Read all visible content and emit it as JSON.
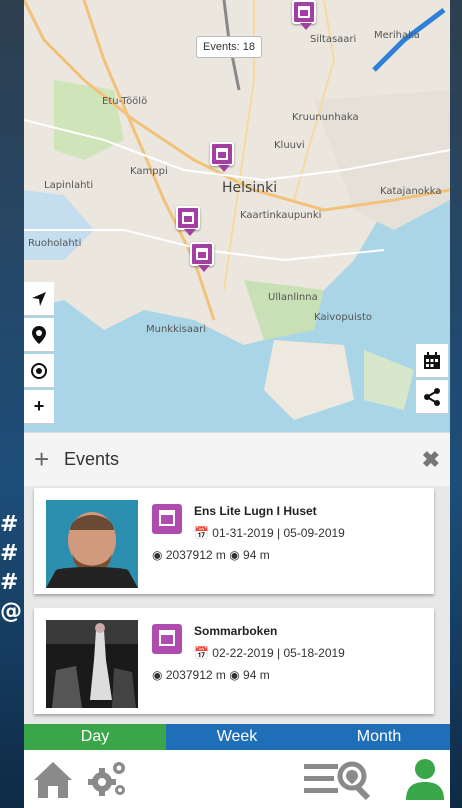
{
  "hash_marks": [
    "#",
    "#",
    "#",
    "@"
  ],
  "map": {
    "events_count": "Events: 18",
    "labels": {
      "helsinki": "Helsinki",
      "kamppi": "Kamppi",
      "kruununhaka": "Kruununhaka",
      "kaartinkaupunki": "Kaartinkaupunki",
      "ullanlinna": "Ullanlinna",
      "kaivopuisto": "Kaivopuisto",
      "munkkisaari": "Munkkisaari",
      "katajanokka": "Katajanokka",
      "lapinlahti": "Lapinlahti",
      "ruoholahti": "Ruoholahti",
      "etu_toolo": "Etu-Töölö",
      "kluuvi": "Kluuvi",
      "merihaka": "Merihaka",
      "siltasaari": "Siltasaari"
    },
    "controls": {
      "locate": "locate-arrow",
      "place": "map-pin",
      "center": "target",
      "zoom_in": "+"
    },
    "right_controls": {
      "calendar": "calendar",
      "share": "share"
    }
  },
  "events_panel": {
    "title": "Events",
    "add_icon": "+",
    "close_icon": "✖",
    "items": [
      {
        "name": "Ens Lite Lugn I Huset",
        "dates": "01-31-2019 | 05-09-2019",
        "distance": "2037912 m",
        "proximity": "94 m"
      },
      {
        "name": "Sommarboken",
        "dates": "02-22-2019 | 05-18-2019",
        "distance": "2037912 m",
        "proximity": "94 m"
      }
    ]
  },
  "tabs": {
    "day": "Day",
    "week": "Week",
    "month": "Month"
  },
  "bottom_bar": {
    "home": "home-icon",
    "settings": "gears-icon",
    "menu": "menu-search-icon",
    "profile": "user-icon"
  },
  "colors": {
    "marker": "#a23fa3",
    "day_tab": "#3aa64a",
    "week_tab": "#1f6fb8",
    "icon_gray": "#8a8a8a",
    "profile_green": "#3aa64a"
  }
}
